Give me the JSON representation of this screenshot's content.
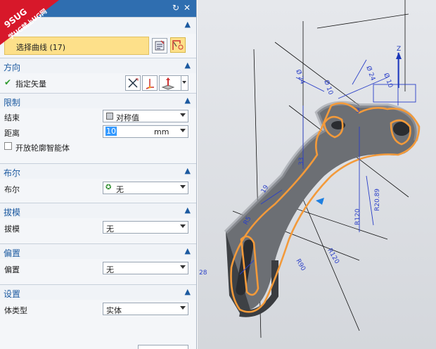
{
  "watermark": {
    "line1": "9SUG",
    "line2": "学UG就上UG网"
  },
  "titlebar": {
    "reset_icon": "reset-icon",
    "close_icon": "close-icon"
  },
  "section_curve": {
    "collapse_icon": "chevron-up-icon",
    "select_label": "选择曲线 (17)"
  },
  "section_direction": {
    "title": "方向",
    "vector_label": "指定矢量"
  },
  "section_limits": {
    "title": "限制",
    "end_label": "结束",
    "end_value": "对称值",
    "distance_label": "距离",
    "distance_value": "10",
    "distance_unit": "mm",
    "open_profile_label": "开放轮廓智能体"
  },
  "section_boolean": {
    "title": "布尔",
    "label": "布尔",
    "value": "无"
  },
  "section_draft": {
    "title": "拔模",
    "label": "拔模",
    "value": "无"
  },
  "section_offset": {
    "title": "偏置",
    "label": "偏置",
    "value": "无"
  },
  "section_settings": {
    "title": "设置",
    "body_type_label": "体类型",
    "body_type_value": "实体"
  },
  "viewport": {
    "dimensions": [
      "Ø 24",
      "Ø 10",
      "Ø 24",
      "Ø 10",
      "3",
      "R120",
      "R120",
      "R90",
      "R20.89",
      "R5",
      "19",
      "33",
      "28"
    ]
  }
}
